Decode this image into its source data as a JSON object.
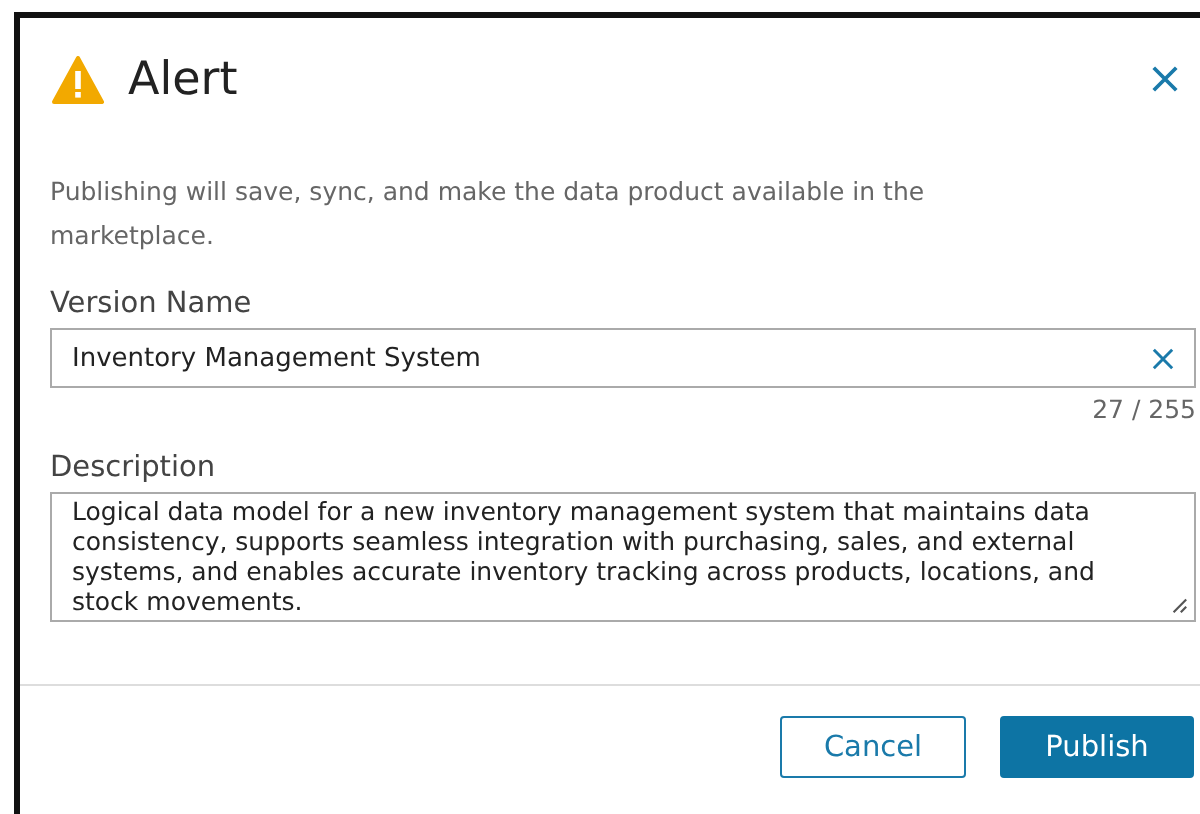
{
  "dialog": {
    "title": "Alert",
    "message": "Publishing will save, sync, and make the data product available in the marketplace.",
    "version_name": {
      "label": "Version Name",
      "value": "Inventory Management System",
      "counter": "27 / 255"
    },
    "description": {
      "label": "Description",
      "value": "Logical data model for a new inventory management system that maintains data consistency, supports seamless integration with purchasing, sales, and external systems, and enables accurate inventory tracking across products, locations, and stock movements."
    },
    "buttons": [
      {
        "label": "Cancel",
        "kind": "secondary"
      },
      {
        "label": "Publish",
        "kind": "primary"
      }
    ]
  }
}
